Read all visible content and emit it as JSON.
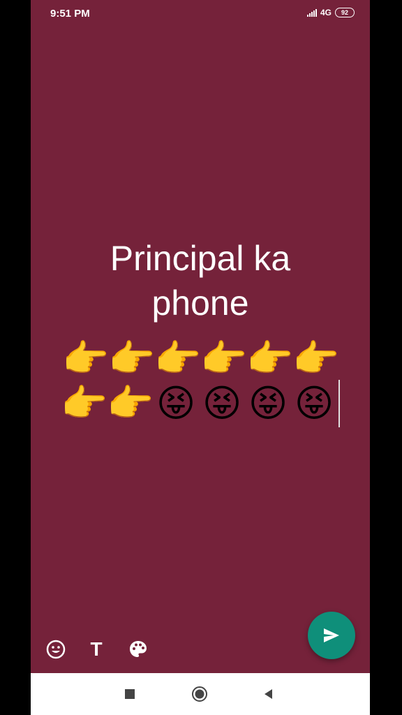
{
  "status_bar": {
    "time": "9:51 PM",
    "network": "4G",
    "battery": "92"
  },
  "status": {
    "line1": "Principal ka",
    "line2": "phone",
    "emoji_row1": [
      "👉",
      "👉",
      "👉",
      "👉",
      "👉",
      "👉"
    ],
    "emoji_row2": [
      "👉",
      "👉",
      "😝",
      "😝",
      "😝",
      "😝"
    ]
  },
  "toolbar": {
    "emoji_icon": "smiley-icon",
    "text_icon": "text-T-icon",
    "text_label": "T",
    "palette_icon": "palette-icon",
    "send_icon": "send-icon"
  },
  "colors": {
    "background": "#75223a",
    "fab": "#0f8f7a"
  },
  "nav": {
    "recents_icon": "square-icon",
    "home_icon": "circle-icon",
    "back_icon": "triangle-back-icon"
  }
}
